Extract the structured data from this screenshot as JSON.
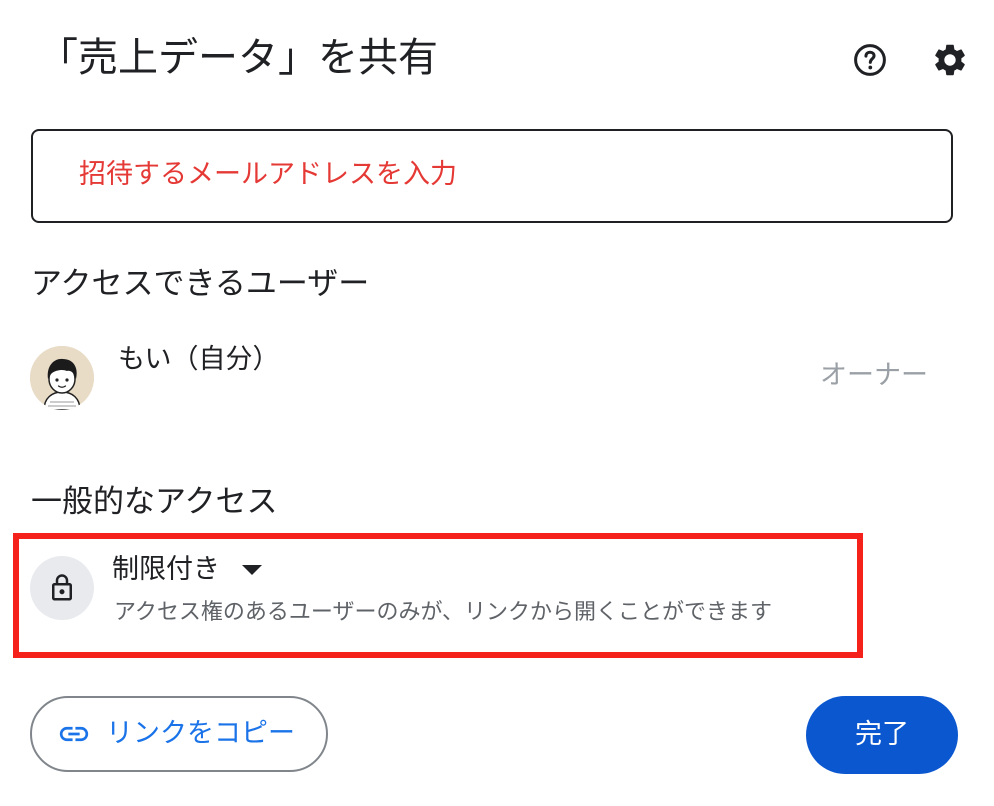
{
  "dialog": {
    "title": "「売上データ」を共有",
    "help_icon": "help-circle-icon",
    "settings_icon": "gear-icon"
  },
  "invite": {
    "placeholder": "招待するメールアドレスを入力"
  },
  "people_section": {
    "heading": "アクセスできるユーザー",
    "users": [
      {
        "name": "もい（自分）",
        "role": "オーナー",
        "avatar": "avatar-illustration"
      }
    ]
  },
  "general_access": {
    "heading": "一般的なアクセス",
    "icon": "lock-icon",
    "selected_option": "制限付き",
    "description": "アクセス権のあるユーザーのみが、リンクから開くことができます",
    "highlight_color": "#f5221b"
  },
  "footer": {
    "copy_link_icon": "link-icon",
    "copy_link_label": "リンクをコピー",
    "done_label": "完了"
  },
  "colors": {
    "placeholder_text": "#e53935",
    "primary_button": "#0b57d0",
    "link_text": "#1a73e8",
    "secondary_text": "#5f6368",
    "muted_text": "#9aa0a6"
  }
}
